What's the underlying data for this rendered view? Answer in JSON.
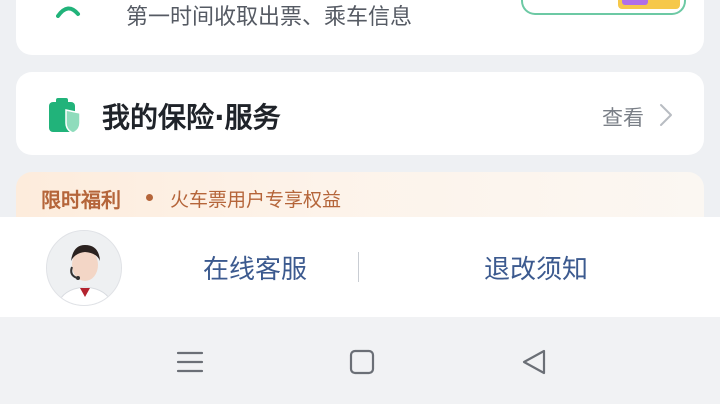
{
  "notify_card": {
    "subtitle": "第一时间收取出票、乘车信息"
  },
  "insurance": {
    "title": "我的保险·服务",
    "link_label": "查看",
    "icon": "insurance-shield-icon",
    "accent": "#21b37a"
  },
  "promo": {
    "label": "限时福利",
    "text": "火车票用户专享权益",
    "color": "#b5653a"
  },
  "service": {
    "online_service": "在线客服",
    "refund_notice": "退改须知",
    "link_color": "#3c5a8f"
  },
  "navigation": {
    "menu_icon": "menu-icon",
    "home_icon": "home-square-icon",
    "back_icon": "back-triangle-icon"
  }
}
